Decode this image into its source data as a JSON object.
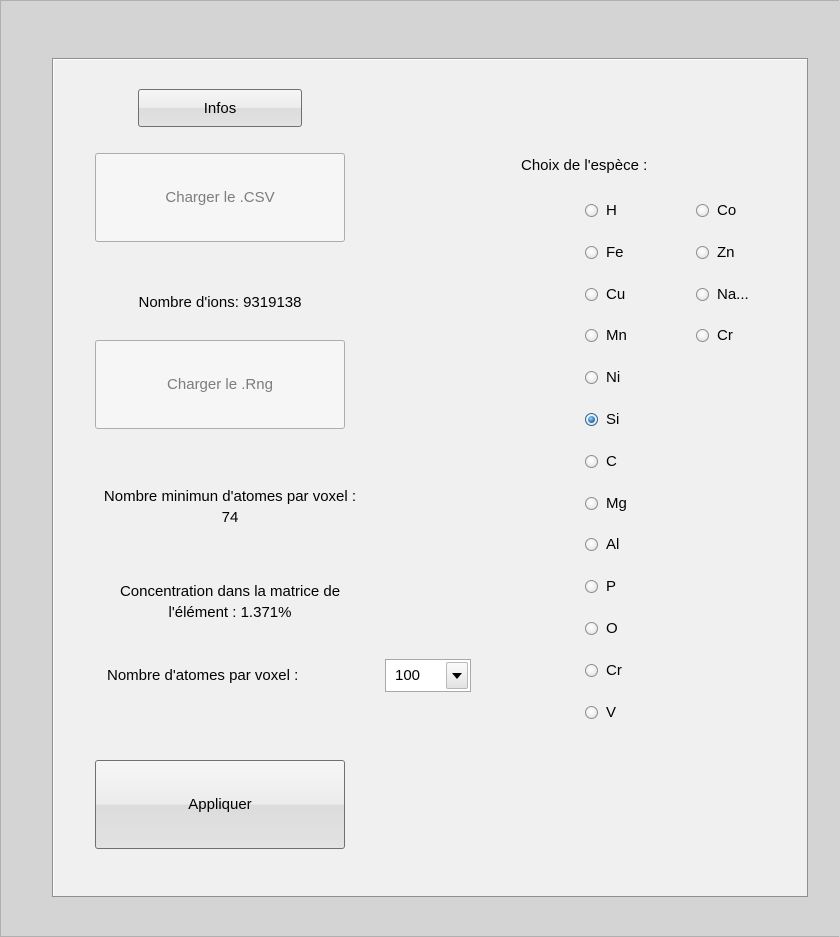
{
  "buttons": {
    "infos": "Infos",
    "load_csv": "Charger le .CSV",
    "load_rng": "Charger le .Rng",
    "apply": "Appliquer"
  },
  "labels": {
    "ion_count": "Nombre d'ions: 9319138",
    "min_atoms_line1": "Nombre minimun d'atomes par voxel :",
    "min_atoms_line2": "74",
    "concentration_line1": "Concentration dans la matrice de",
    "concentration_line2": "l'élément : 1.371%",
    "atoms_per_voxel": "Nombre  d'atomes par voxel :",
    "species_title": "Choix de l'espèce :"
  },
  "atoms_select": {
    "value": "100"
  },
  "species": {
    "selected": "Si",
    "column1": [
      "H",
      "Fe",
      "Cu",
      "Mn",
      "Ni",
      "Si",
      "C",
      "Mg",
      "Al",
      "P",
      "O",
      "Cr",
      "V"
    ],
    "column2": [
      "Co",
      "Zn",
      "Na...",
      "Cr"
    ]
  },
  "colors": {
    "window_bg": "#d4d4d4",
    "panel_bg": "#f0f0f0",
    "radio_selected": "#2f7ac3"
  }
}
